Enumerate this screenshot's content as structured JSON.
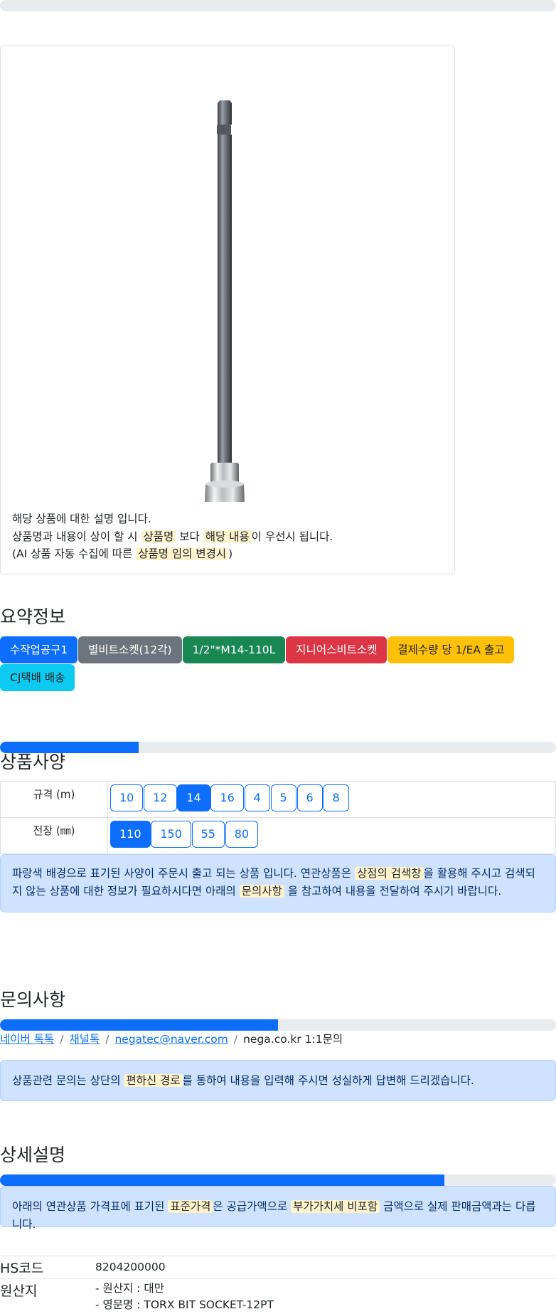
{
  "top_bar": {
    "progress": 0
  },
  "product_card": {
    "image_alt": "1/2\" TORX BIT SOCKET",
    "desc_line1": "해당 상품에 대한 설명 입니다.",
    "desc_line2_a": "상품명과 내용이 상이 할 시",
    "desc_line2_mark1": "상품명",
    "desc_line2_b": "보다",
    "desc_line2_mark2": "해당 내용",
    "desc_line2_c": "이 우선시 됩니다.",
    "desc_line3_a": "(AI 상품 자동 수집에 따른",
    "desc_line3_mark": "상품명 임의 변경시",
    "desc_line3_b": ")"
  },
  "summary": {
    "title": "요약정보",
    "chips": [
      "수작업공구1",
      "별비트소켓(12각)",
      "1/2\"*M14-110L",
      "지니어스비트소켓",
      "결제수량 당 1/EA 출고",
      "CJ택배 배송"
    ]
  },
  "spec": {
    "title": "상품사양",
    "progress": 0.25,
    "rows": [
      {
        "label": "규격 (m)",
        "options": [
          "10",
          "12",
          "14",
          "16",
          "4",
          "5",
          "6",
          "8"
        ],
        "selected": "14"
      },
      {
        "label": "전장 (㎜)",
        "options": [
          "110",
          "150",
          "55",
          "80"
        ],
        "selected": "110"
      }
    ],
    "notice_a": "파랑색 배경으로 표기된 사양이 주문시 출고 되는 상품 입니다. 연관상품은",
    "notice_mark1": "상점의 검색창",
    "notice_b": "을 활용해 주시고 검색되지 않는 상품에 대한 정보가 필요하시다면 아래의",
    "notice_mark2": "문의사항",
    "notice_c": "을 참고하여 내용을 전달하여 주시기 바랍니다."
  },
  "inquiry": {
    "title": "문의사항",
    "progress": 0.5,
    "links": [
      "네이버 톡톡",
      "채널톡",
      "negatec@naver.com"
    ],
    "last": "nega.co.kr 1:1문의",
    "notice_a": "상품관련 문의는 상단의",
    "notice_mark": "편하신 경로",
    "notice_b": "를 통하여 내용을 입력해 주시면 성실하게 답변해 드리겠습니다."
  },
  "detail": {
    "title": "상세설명",
    "progress": 0.8,
    "notice_a": "아래의 연관상품 가격표에 표기된",
    "notice_mark1": "표준가격",
    "notice_b": "은 공급가액으로",
    "notice_mark2": "부가가치세 비포함",
    "notice_c": "금액으로 실제 판매금액과는 다릅니다."
  },
  "info": {
    "hs_label": "HS코드",
    "hs_value": "8204200000",
    "origin_label": "원산지",
    "origin_line1": "- 원산지 : 대만",
    "origin_line2": "- 영문명 : TORX BIT SOCKET-12PT"
  }
}
